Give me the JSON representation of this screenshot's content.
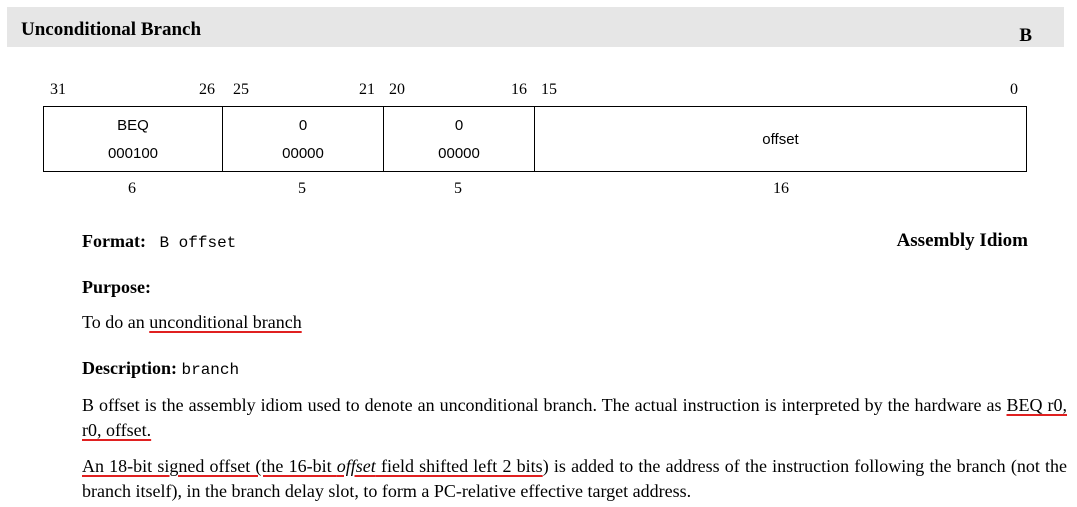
{
  "header": {
    "title": "Unconditional Branch",
    "mnemonic": "B"
  },
  "encoding": {
    "bit_numbers": [
      "31",
      "26",
      "25",
      "21",
      "20",
      "16",
      "15",
      "0"
    ],
    "fields": [
      {
        "name": "BEQ",
        "value": "000100",
        "width": "6"
      },
      {
        "name": "0",
        "value": "00000",
        "width": "5"
      },
      {
        "name": "0",
        "value": "00000",
        "width": "5"
      },
      {
        "name": "offset",
        "value": "",
        "width": "16"
      }
    ]
  },
  "format": {
    "label": "Format:",
    "syntax": "B offset",
    "type": "Assembly Idiom"
  },
  "purpose": {
    "heading": "Purpose:",
    "pre": "To do an ",
    "link": "unconditional branch"
  },
  "description": {
    "heading": "Description:",
    "code": "branch",
    "p1_a": "B offset is the assembly idiom used to denote an unconditional branch. The actual instruction is interpreted by the hardware as ",
    "p1_b": "BEQ r0, r0, offset.",
    "p2_a": "An 18-bit signed offset (the 16-bit ",
    "p2_em": "offset",
    "p2_b": " field shifted left 2 bits",
    "p2_c": ") is added to the address of the instruction following the branch (not the branch itself), in the branch delay slot, to form a PC-relative effective target address."
  }
}
